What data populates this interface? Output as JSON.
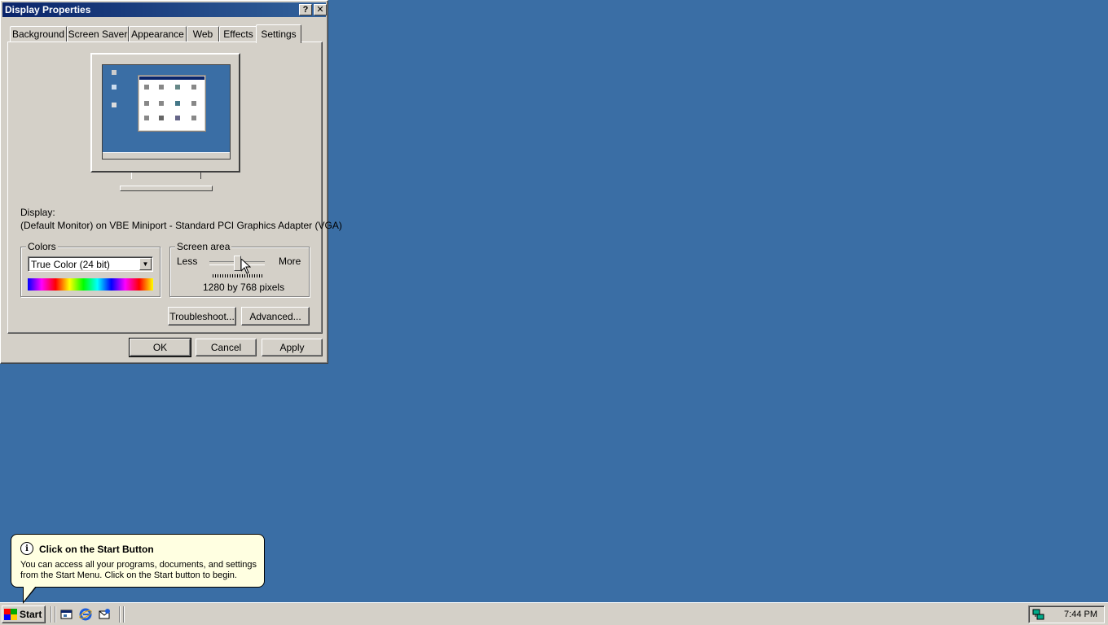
{
  "window": {
    "title": "Display Properties",
    "help_button": "?",
    "close_button": "✕"
  },
  "tabs": [
    {
      "label": "Background"
    },
    {
      "label": "Screen Saver"
    },
    {
      "label": "Appearance"
    },
    {
      "label": "Web"
    },
    {
      "label": "Effects"
    },
    {
      "label": "Settings",
      "active": true
    }
  ],
  "settings": {
    "display_label": "Display:",
    "display_value": "(Default Monitor) on VBE Miniport - Standard PCI Graphics Adapter (VGA)",
    "colors_group": "Colors",
    "colors_selected": "True Color (24 bit)",
    "screen_area_group": "Screen area",
    "slider_less": "Less",
    "slider_more": "More",
    "slider_level": 0.5,
    "resolution_text": "1280 by 768 pixels",
    "troubleshoot_button": "Troubleshoot...",
    "advanced_button": "Advanced..."
  },
  "dialog_buttons": {
    "ok": "OK",
    "cancel": "Cancel",
    "apply": "Apply"
  },
  "balloon": {
    "title": "Click on the Start Button",
    "text": "You can access all your programs, documents, and settings from the Start Menu. Click on the Start button to begin.",
    "icon": "info-icon"
  },
  "taskbar": {
    "start_label": "Start",
    "quick_launch": [
      "show-desktop-icon",
      "internet-explorer-icon",
      "outlook-express-icon"
    ],
    "clock": "7:44 PM"
  },
  "colors": {
    "desktop": "#3a6ea5",
    "face": "#d4d0c8",
    "titlebar": "#0a246a",
    "tooltip": "#ffffe1"
  }
}
